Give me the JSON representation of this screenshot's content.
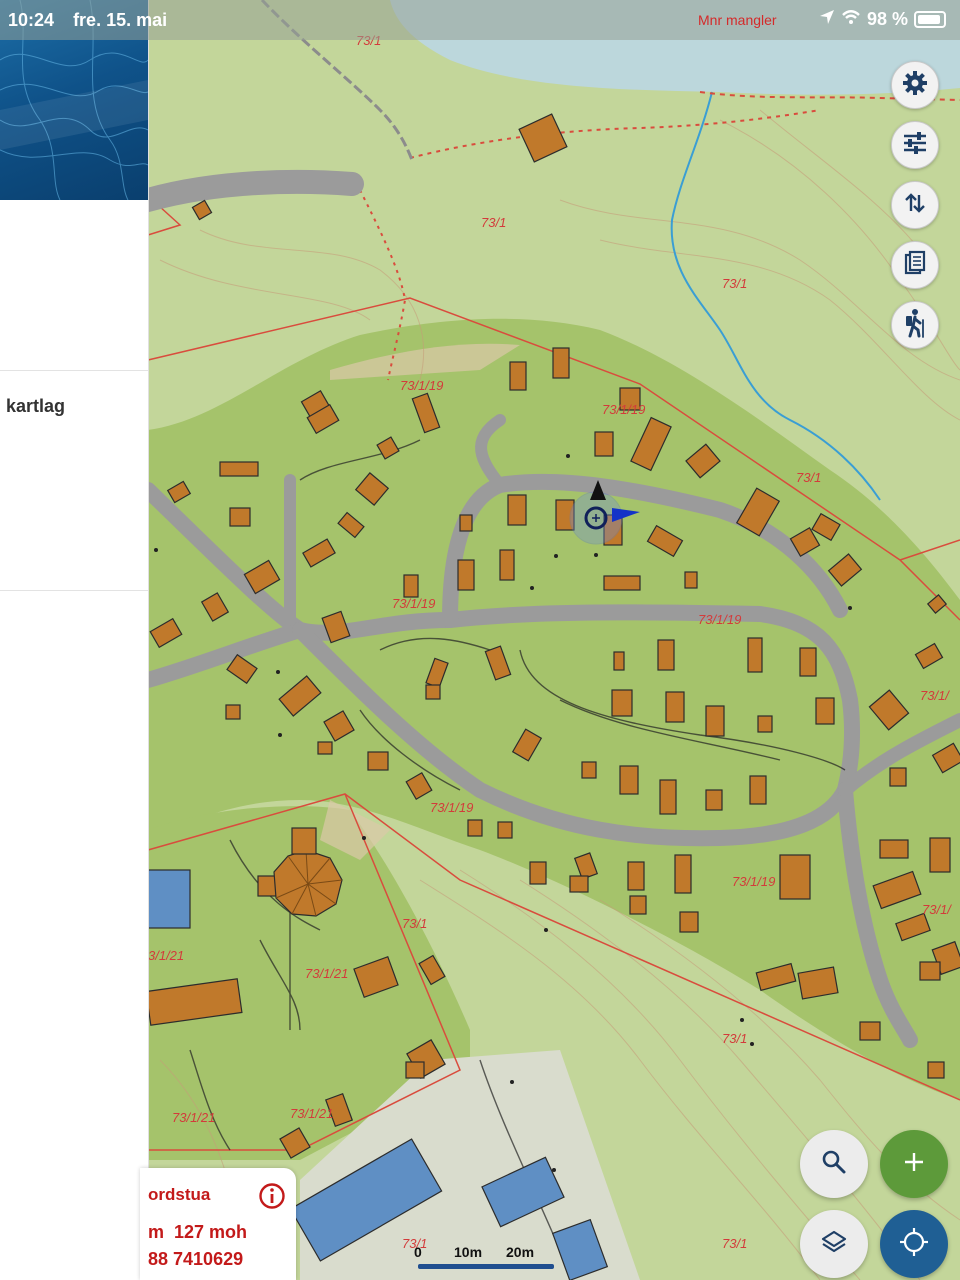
{
  "status_bar": {
    "time": "10:24",
    "date": "fre. 15. mai",
    "notice": "Mnr mangler",
    "battery": "98 %"
  },
  "side_panel": {
    "label": "kartlag"
  },
  "map": {
    "parcel_labels": {
      "a": "73/1",
      "b": "73/1/19",
      "c": "73/1/21",
      "d": "3/1/21",
      "e": "73/1/",
      "f": "73/1"
    },
    "colors": {
      "grass": "#c3d69a",
      "built_area": "#a5c36b",
      "road": "#9b9b9b",
      "building": "#c0792b",
      "water": "#bcd7dc",
      "boundary": "#d94c3d",
      "blue_building": "#5f8fc4"
    }
  },
  "info_card": {
    "name": "ordstua",
    "altitude": "m  127 moh",
    "phone": "88 7410629"
  },
  "scale_bar": {
    "zero": "0",
    "mid": "10m",
    "max": "20m"
  },
  "right_controls": [
    "gear-icon",
    "sliders-icon",
    "sort-arrows-icon",
    "document-icon",
    "hiker-icon"
  ],
  "bottom_controls": [
    "search-icon",
    "plus-icon",
    "layers-icon",
    "locate-icon"
  ]
}
